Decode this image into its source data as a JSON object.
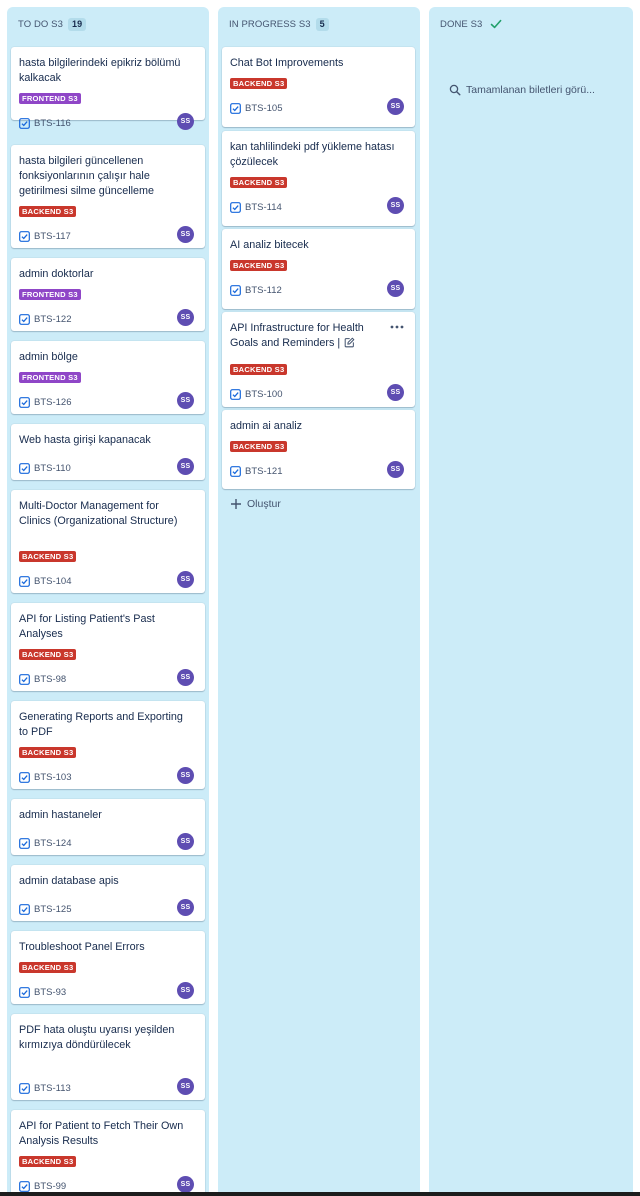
{
  "columns": {
    "todo": {
      "title": "TO DO S3",
      "count": "19",
      "cards": [
        {
          "title": "hasta bilgilerindeki epikriz bölümü kalkacak",
          "label": "FRONTEND S3",
          "key": "BTS-116",
          "assignee": "SS"
        },
        {
          "title": "hasta bilgileri güncellenen fonksiyonlarının çalışır hale getirilmesi silme güncelleme",
          "label": "BACKEND S3",
          "key": "BTS-117",
          "assignee": "SS"
        },
        {
          "title": "admin doktorlar",
          "label": "FRONTEND S3",
          "key": "BTS-122",
          "assignee": "SS"
        },
        {
          "title": "admin bölge",
          "label": "FRONTEND S3",
          "key": "BTS-126",
          "assignee": "SS"
        },
        {
          "title": "Web hasta girişi kapanacak",
          "label": "",
          "key": "BTS-110",
          "assignee": "SS"
        },
        {
          "title": "Multi-Doctor Management for Clinics (Organizational Structure)",
          "label": "BACKEND S3",
          "key": "BTS-104",
          "assignee": "SS"
        },
        {
          "title": "API for Listing Patient's Past Analyses",
          "label": "BACKEND S3",
          "key": "BTS-98",
          "assignee": "SS"
        },
        {
          "title": "Generating Reports and Exporting to PDF",
          "label": "BACKEND S3",
          "key": "BTS-103",
          "assignee": "SS"
        },
        {
          "title": "admin hastaneler",
          "label": "",
          "key": "BTS-124",
          "assignee": "SS"
        },
        {
          "title": "admin database apis",
          "label": "",
          "key": "BTS-125",
          "assignee": "SS"
        },
        {
          "title": "Troubleshoot Panel Errors",
          "label": "BACKEND S3",
          "key": "BTS-93",
          "assignee": "SS"
        },
        {
          "title": "PDF hata oluştu uyarısı yeşilden kırmızıya döndürülecek",
          "label": "",
          "key": "BTS-113",
          "assignee": "SS"
        },
        {
          "title": "API for Patient to Fetch Their Own Analysis Results",
          "label": "BACKEND S3",
          "key": "BTS-99",
          "assignee": "SS"
        }
      ]
    },
    "in_progress": {
      "title": "IN PROGRESS S3",
      "count": "5",
      "cards": [
        {
          "title": "Chat Bot Improvements",
          "label": "BACKEND S3",
          "key": "BTS-105",
          "assignee": "SS"
        },
        {
          "title": "kan tahlilindeki pdf yükleme hatası çözülecek",
          "label": "BACKEND S3",
          "key": "BTS-114",
          "assignee": "SS"
        },
        {
          "title": "AI analiz bitecek",
          "label": "BACKEND S3",
          "key": "BTS-112",
          "assignee": "SS"
        },
        {
          "title": "API Infrastructure for Health Goals and Reminders |",
          "label": "BACKEND S3",
          "key": "BTS-100",
          "assignee": "SS"
        },
        {
          "title": "admin ai analiz",
          "label": "BACKEND S3",
          "key": "BTS-121",
          "assignee": "SS"
        }
      ],
      "create_label": "Oluştur"
    },
    "done": {
      "title": "DONE S3",
      "search_text": "Tamamlanan biletleri görü..."
    }
  },
  "colors": {
    "column_bg": "#ccecf8",
    "frontend_label": "#8f46c7",
    "backend_label": "#c9372c",
    "avatar": "#5e4db2",
    "done_check": "#22a06b",
    "checkbox": "#1868db"
  },
  "icons": {
    "card_type": "checkbox-icon",
    "done": "checkmark-icon",
    "create": "plus-icon",
    "search": "search-icon",
    "card_menu": "more-horizontal-icon",
    "edit": "edit-icon"
  }
}
